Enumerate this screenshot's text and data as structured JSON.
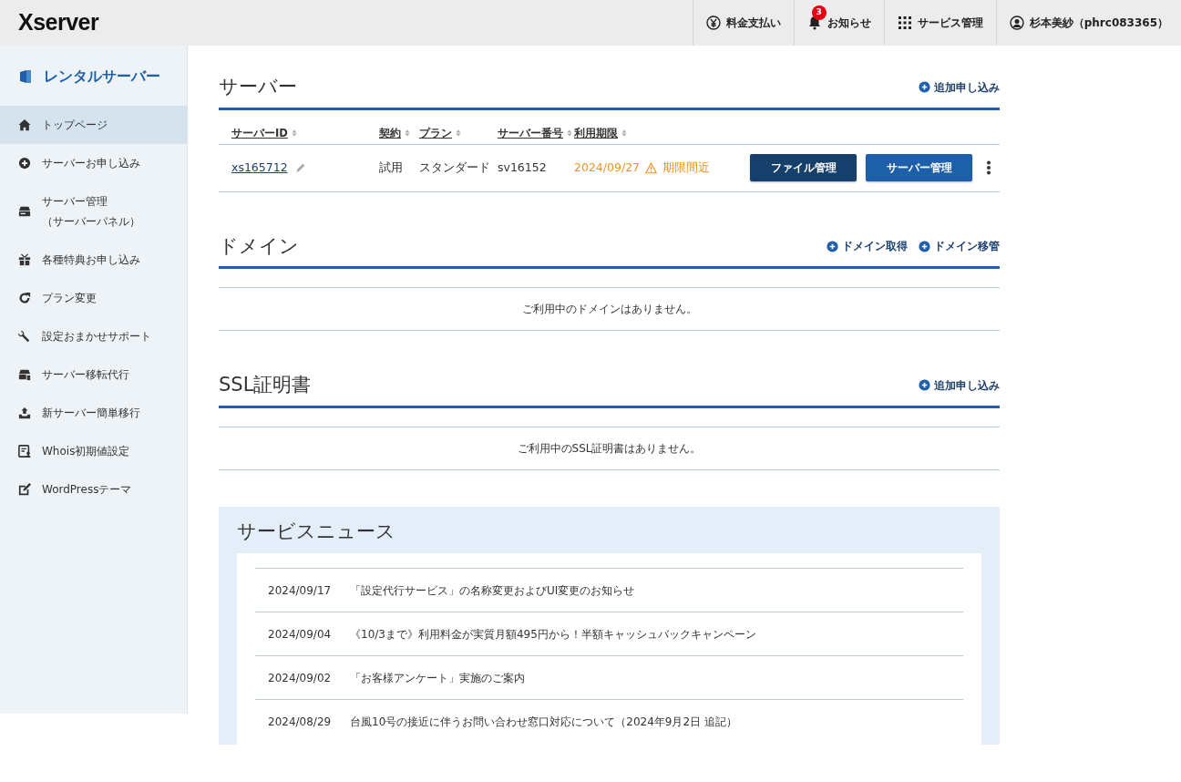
{
  "header": {
    "logo": "Xserver",
    "items": [
      {
        "kind": "yen",
        "label": "料金支払い"
      },
      {
        "kind": "bell",
        "label": "お知らせ",
        "badge": "3"
      },
      {
        "kind": "grid",
        "label": "サービス管理"
      },
      {
        "kind": "user",
        "label": "杉本美紗（phrc083365）"
      }
    ]
  },
  "sidebar": {
    "title": "レンタルサーバー",
    "items": [
      {
        "kind": "home",
        "label": "トップページ",
        "selected": true
      },
      {
        "kind": "plus",
        "label": "サーバーお申し込み",
        "selected": false
      },
      {
        "kind": "server",
        "label": "サーバー管理",
        "sublabel": "（サーバーパネル）",
        "selected": false
      },
      {
        "kind": "gift",
        "label": "各種特典お申し込み",
        "selected": false
      },
      {
        "kind": "refresh",
        "label": "プラン変更",
        "selected": false
      },
      {
        "kind": "wrench",
        "label": "設定おまかせサポート",
        "selected": false
      },
      {
        "kind": "move",
        "label": "サーバー移転代行",
        "selected": false
      },
      {
        "kind": "upload",
        "label": "新サーバー簡単移行",
        "selected": false
      },
      {
        "kind": "whois",
        "label": "Whois初期値設定",
        "selected": false
      },
      {
        "kind": "edit",
        "label": "WordPressテーマ",
        "selected": false
      }
    ]
  },
  "server": {
    "title": "サーバー",
    "actions": [
      "追加申し込み"
    ],
    "columns": [
      "サーバーID",
      "契約",
      "プラン",
      "サーバー番号",
      "利用期限"
    ],
    "rows": [
      {
        "id": "xs165712",
        "contract": "試用",
        "plan": "スタンダード",
        "number": "sv16152",
        "expiry": "2024/09/27",
        "warning": "期限間近",
        "buttons": [
          "ファイル管理",
          "サーバー管理"
        ]
      }
    ]
  },
  "domain": {
    "title": "ドメイン",
    "actions": [
      "ドメイン取得",
      "ドメイン移管"
    ],
    "empty": "ご利用中のドメインはありません。"
  },
  "ssl": {
    "title": "SSL証明書",
    "actions": [
      "追加申し込み"
    ],
    "empty": "ご利用中のSSL証明書はありません。"
  },
  "news": {
    "title": "サービスニュース",
    "items": [
      {
        "date": "2024/09/17",
        "text": "「設定代行サービス」の名称変更およびUI変更のお知らせ"
      },
      {
        "date": "2024/09/04",
        "text": "《10/3まで》利用料金が実質月額495円から！半額キャッシュバックキャンペーン"
      },
      {
        "date": "2024/09/02",
        "text": "「お客様アンケート」実施のご案内"
      },
      {
        "date": "2024/08/29",
        "text": "台風10号の接近に伴うお問い合わせ窓口対応について（2024年9月2日 追記）"
      }
    ]
  }
}
